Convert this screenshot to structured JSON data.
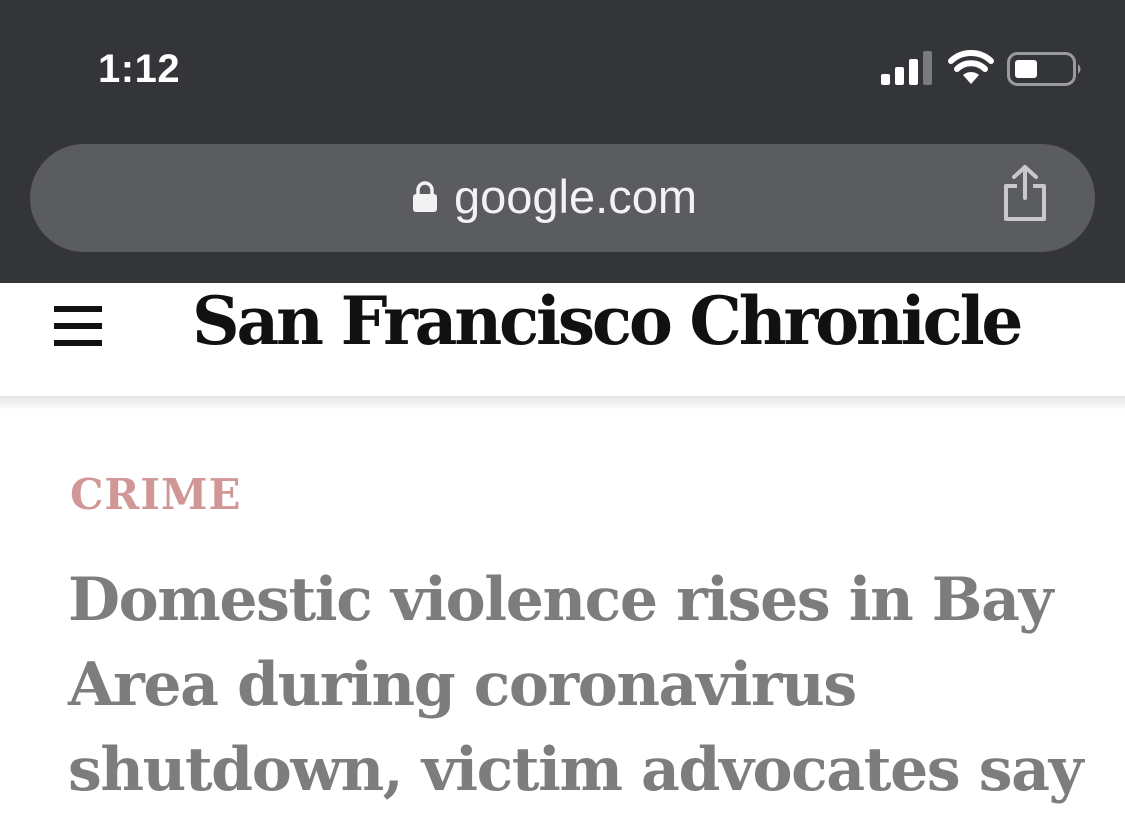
{
  "status_bar": {
    "time": "1:12"
  },
  "address_bar": {
    "url": "google.com",
    "icons": [
      "lock-icon",
      "share-icon"
    ]
  },
  "site": {
    "masthead": "San Francisco Chronicle",
    "icons": [
      "hamburger-menu-icon"
    ]
  },
  "article": {
    "section": "CRIME",
    "headline": "Domestic violence rises in Bay Area during coronavirus shutdown, victim advocates say"
  },
  "colors": {
    "chrome_background": "#343538",
    "url_bar_background": "#5b5c60",
    "section_label": "#d19696",
    "headline": "#7d7d7d"
  }
}
